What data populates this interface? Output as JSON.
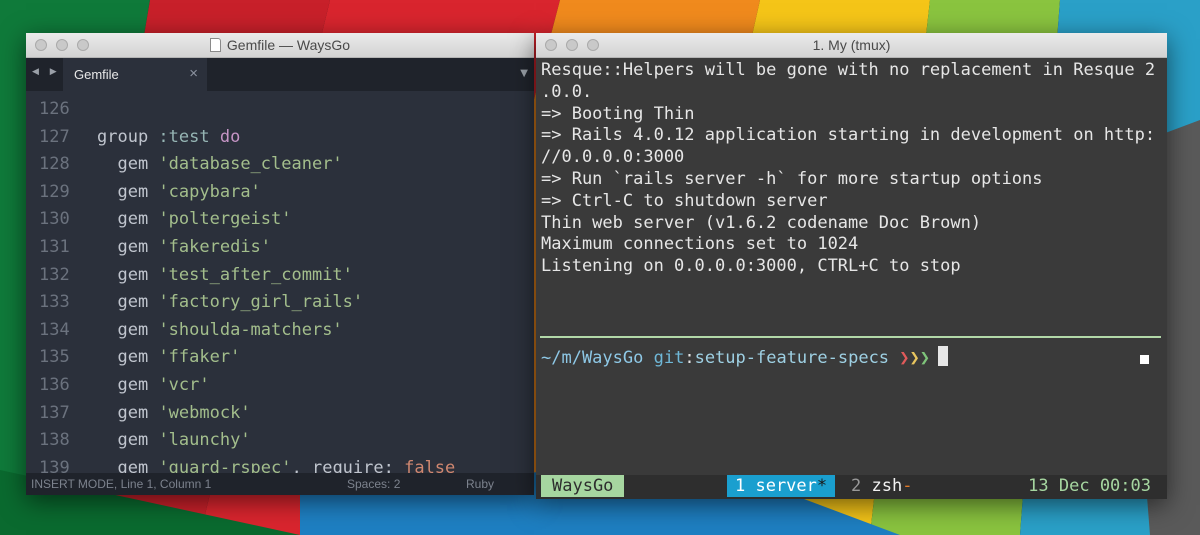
{
  "sublime": {
    "title": "Gemfile — WaysGo",
    "tab_label": "Gemfile",
    "tab_close": "×",
    "nav_arrows": "◀ ▶",
    "dropdown": "▼",
    "lines": [
      {
        "num": "126",
        "indent": "",
        "tokens": []
      },
      {
        "num": "127",
        "indent": "",
        "tokens": [
          {
            "t": "group ",
            "c": "plain"
          },
          {
            "t": ":test",
            "c": "sym"
          },
          {
            "t": " ",
            "c": "plain"
          },
          {
            "t": "do",
            "c": "kw"
          }
        ]
      },
      {
        "num": "128",
        "indent": "  ",
        "tokens": [
          {
            "t": "gem ",
            "c": "plain"
          },
          {
            "t": "'database_cleaner'",
            "c": "str"
          }
        ]
      },
      {
        "num": "129",
        "indent": "  ",
        "tokens": [
          {
            "t": "gem ",
            "c": "plain"
          },
          {
            "t": "'capybara'",
            "c": "str"
          }
        ]
      },
      {
        "num": "130",
        "indent": "  ",
        "tokens": [
          {
            "t": "gem ",
            "c": "plain"
          },
          {
            "t": "'poltergeist'",
            "c": "str"
          }
        ]
      },
      {
        "num": "131",
        "indent": "  ",
        "tokens": [
          {
            "t": "gem ",
            "c": "plain"
          },
          {
            "t": "'fakeredis'",
            "c": "str"
          }
        ]
      },
      {
        "num": "132",
        "indent": "  ",
        "tokens": [
          {
            "t": "gem ",
            "c": "plain"
          },
          {
            "t": "'test_after_commit'",
            "c": "str"
          }
        ]
      },
      {
        "num": "133",
        "indent": "  ",
        "tokens": [
          {
            "t": "gem ",
            "c": "plain"
          },
          {
            "t": "'factory_girl_rails'",
            "c": "str"
          }
        ]
      },
      {
        "num": "134",
        "indent": "  ",
        "tokens": [
          {
            "t": "gem ",
            "c": "plain"
          },
          {
            "t": "'shoulda-matchers'",
            "c": "str"
          }
        ]
      },
      {
        "num": "135",
        "indent": "  ",
        "tokens": [
          {
            "t": "gem ",
            "c": "plain"
          },
          {
            "t": "'ffaker'",
            "c": "str"
          }
        ]
      },
      {
        "num": "136",
        "indent": "  ",
        "tokens": [
          {
            "t": "gem ",
            "c": "plain"
          },
          {
            "t": "'vcr'",
            "c": "str"
          }
        ]
      },
      {
        "num": "137",
        "indent": "  ",
        "tokens": [
          {
            "t": "gem ",
            "c": "plain"
          },
          {
            "t": "'webmock'",
            "c": "str"
          }
        ]
      },
      {
        "num": "138",
        "indent": "  ",
        "tokens": [
          {
            "t": "gem ",
            "c": "plain"
          },
          {
            "t": "'launchy'",
            "c": "str"
          }
        ]
      },
      {
        "num": "139",
        "indent": "  ",
        "tokens": [
          {
            "t": "gem ",
            "c": "plain"
          },
          {
            "t": "'guard-rspec'",
            "c": "str"
          },
          {
            "t": ", require: ",
            "c": "plain"
          },
          {
            "t": "false",
            "c": "bool"
          }
        ]
      }
    ],
    "status": {
      "mode": "INSERT MODE, Line 1, Column 1",
      "spaces": "Spaces: 2",
      "syntax": "Ruby"
    }
  },
  "terminal": {
    "title": "1. My (tmux)",
    "output": [
      "Resque::Helpers will be gone with no replacement in Resque 2",
      ".0.0.",
      "=> Booting Thin",
      "=> Rails 4.0.12 application starting in development on http:",
      "//0.0.0.0:3000",
      "=> Run `rails server -h` for more startup options",
      "=> Ctrl-C to shutdown server",
      "Thin web server (v1.6.2 codename Doc Brown)",
      "Maximum connections set to 1024",
      "Listening on 0.0.0.0:3000, CTRL+C to stop"
    ],
    "prompt": {
      "path": "~/m/WaysGo",
      "git": "git",
      "colon": ":",
      "branch": "setup-feature-specs",
      "chevrons": [
        "❯",
        "❯",
        "❯"
      ]
    },
    "tmux": {
      "session": "WaysGo",
      "win1": "1 server",
      "win1_flag": "*",
      "win2_num": "2",
      "win2_name": "zsh",
      "win2_flag": "-",
      "clock": "13 Dec 00:03"
    }
  },
  "colors": {
    "editor_bg": "#2b303b",
    "terminal_bg": "#3a3a3a",
    "string": "#a3be8c",
    "keyword": "#c594c5",
    "symbol": "#96b5b4",
    "tmux_accent": "#1a9fcf",
    "tmux_green": "#a6d6a0"
  }
}
